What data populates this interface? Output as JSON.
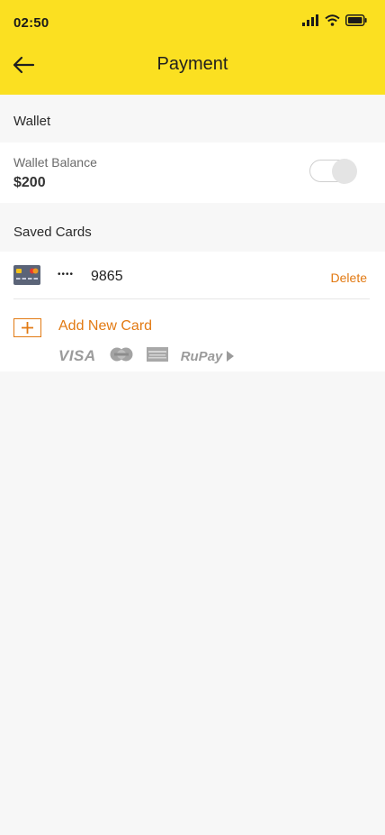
{
  "status_bar": {
    "time": "02:50"
  },
  "nav": {
    "title": "Payment"
  },
  "wallet": {
    "section_title": "Wallet",
    "balance_label": "Wallet Balance",
    "balance_value": "$200",
    "toggle_on": false
  },
  "saved_cards": {
    "section_title": "Saved Cards",
    "cards": [
      {
        "masked_dots": "••••",
        "last4": "9865",
        "delete_label": "Delete"
      }
    ],
    "add_label": "Add New Card",
    "brands": [
      "VISA",
      "mastercard",
      "amex",
      "RuPay"
    ]
  },
  "colors": {
    "header_bg": "#fbe021",
    "accent": "#e27a13",
    "page_bg": "#f7f7f7"
  }
}
